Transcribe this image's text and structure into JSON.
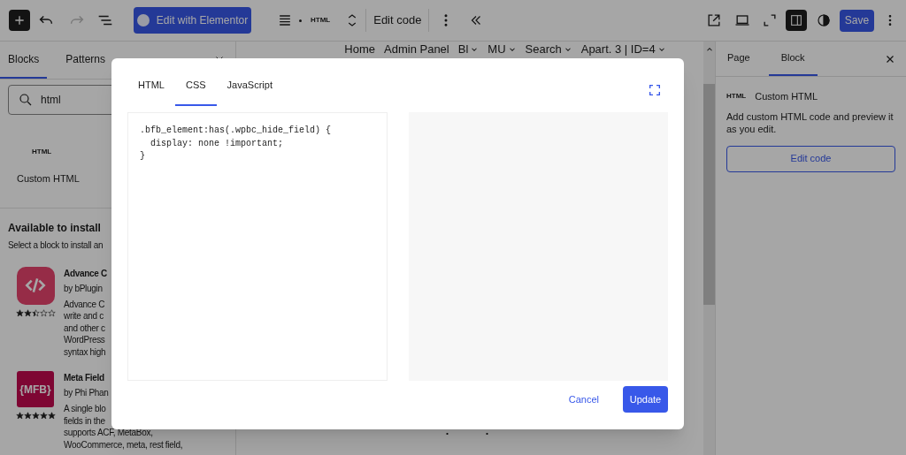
{
  "toolbar": {
    "elementor_button": "Edit with Elementor",
    "block_badge": "HTML",
    "edit_code": "Edit code",
    "save": "Save",
    "sidebar_toggle_on": true
  },
  "inserter": {
    "tabs": [
      {
        "label": "Blocks",
        "selected": true
      },
      {
        "label": "Patterns",
        "selected": false
      }
    ],
    "search": {
      "value": "html"
    },
    "result": {
      "badge": "HTML",
      "label": "Custom HTML"
    },
    "available_heading": "Available to install",
    "available_hint": "Select a block to install an",
    "plugins": [
      {
        "kind": "code-logo",
        "title": "Advance C",
        "author": "by bPlugin",
        "stars": 2.5,
        "lines": [
          "Advance C",
          "write and c",
          "and other c",
          "WordPress",
          "syntax high"
        ]
      },
      {
        "kind": "text-logo",
        "logo_text": "{MFB}",
        "title": "Meta Field",
        "author": "by Phi Phan",
        "stars": 5,
        "lines": [
          "A single blo",
          "fields in the",
          "supports ACF, MetaBox,",
          "WooCommerce, meta, rest field,"
        ]
      }
    ]
  },
  "canvas": {
    "nav": [
      {
        "label": "Home",
        "caret": false
      },
      {
        "label": "Admin Panel",
        "caret": false
      },
      {
        "label": "Bl",
        "caret": true
      },
      {
        "label": "MU",
        "caret": true
      },
      {
        "label": "Search",
        "caret": true
      },
      {
        "label": "Apart. 3 | ID=4",
        "caret": true
      }
    ]
  },
  "settings": {
    "tabs": [
      {
        "label": "Page",
        "selected": false
      },
      {
        "label": "Block",
        "selected": true
      }
    ],
    "badge": "HTML",
    "title": "Custom HTML",
    "description": "Add custom HTML code and preview it as you edit.",
    "button": "Edit code"
  },
  "modal": {
    "tabs": [
      {
        "label": "HTML",
        "selected": false
      },
      {
        "label": "CSS",
        "selected": true
      },
      {
        "label": "JavaScript",
        "selected": false
      }
    ],
    "code": [
      ".bfb_element:has(.wpbc_hide_field) {",
      "  display: none !important;",
      "}"
    ],
    "cancel": "Cancel",
    "update": "Update"
  }
}
